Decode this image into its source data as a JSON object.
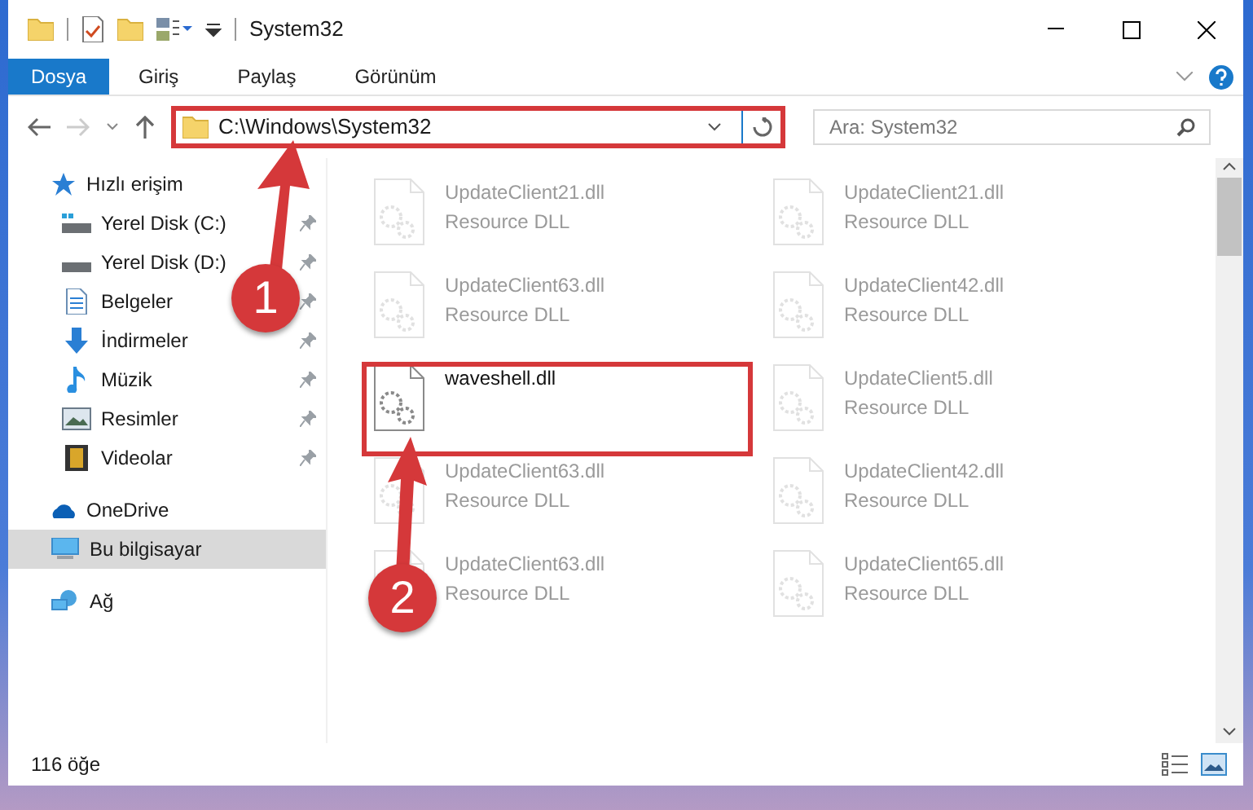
{
  "window": {
    "title": "System32"
  },
  "ribbon_tabs": [
    {
      "label": "Dosya",
      "selected": true
    },
    {
      "label": "Giriş",
      "selected": false
    },
    {
      "label": "Paylaş",
      "selected": false
    },
    {
      "label": "Görünüm",
      "selected": false
    }
  ],
  "address": {
    "path": "C:\\Windows\\System32"
  },
  "search": {
    "placeholder": "Ara: System32"
  },
  "sidebar": {
    "items": [
      {
        "label": "Hızlı erişim",
        "selected": false,
        "children": [
          {
            "label": "Yerel Disk (C:)",
            "pinned": true
          },
          {
            "label": "Yerel Disk (D:)",
            "pinned": true
          },
          {
            "label": "Belgeler",
            "pinned": true
          },
          {
            "label": "İndirmeler",
            "pinned": true
          },
          {
            "label": "Müzik",
            "pinned": true
          },
          {
            "label": "Resimler",
            "pinned": true
          },
          {
            "label": "Videolar",
            "pinned": true
          }
        ]
      },
      {
        "label": "OneDrive",
        "selected": false
      },
      {
        "label": "Bu bilgisayar",
        "selected": true
      },
      {
        "label": "Ağ",
        "selected": false
      }
    ]
  },
  "files": [
    {
      "name": "UpdateClient21.dll",
      "type": "Resource DLL",
      "dimmed": true
    },
    {
      "name": "UpdateClient21.dll",
      "type": "Resource DLL",
      "dimmed": true
    },
    {
      "name": "UpdateClient63.dll",
      "type": "Resource DLL",
      "dimmed": true
    },
    {
      "name": "UpdateClient42.dll",
      "type": "Resource DLL",
      "dimmed": true
    },
    {
      "name": "waveshell.dll",
      "dimmed": false
    },
    {
      "name": "UpdateClient5.dll",
      "type": "Resource DLL",
      "dimmed": true
    },
    {
      "name": "UpdateClient63.dll",
      "type": "Resource DLL",
      "dimmed": true
    },
    {
      "name": "UpdateClient42.dll",
      "type": "Resource DLL",
      "dimmed": true
    },
    {
      "name": "UpdateClient63.dll",
      "type": "Resource DLL",
      "dimmed": true
    },
    {
      "name": "UpdateClient65.dll",
      "type": "Resource DLL",
      "dimmed": true
    }
  ],
  "status_bar": {
    "count": "116 öğe"
  },
  "callouts": [
    {
      "number": "1"
    },
    {
      "number": "2"
    }
  ]
}
